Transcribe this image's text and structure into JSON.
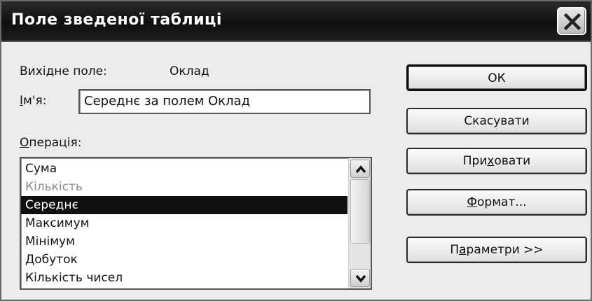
{
  "window": {
    "title": "Поле зведеної таблиці"
  },
  "source_field": {
    "label": "Вихідне поле:",
    "value": "Оклад"
  },
  "name_field": {
    "label_prefix": "І",
    "label_rest": "м'я:",
    "value": "Середнє за полем Оклад"
  },
  "operation": {
    "label_prefix": "О",
    "label_rest": "перація:",
    "items": [
      "Сума",
      "Кількість",
      "Середнє",
      "Максимум",
      "Мінімум",
      "Добуток",
      "Кількість чисел"
    ],
    "selected": "Середнє"
  },
  "buttons": {
    "ok": "ОК",
    "cancel": "Скасувати",
    "hide_before": "При",
    "hide_key": "х",
    "hide_after": "овати",
    "format_key": "Ф",
    "format_after": "ормат...",
    "params_before": "П",
    "params_key": "а",
    "params_after": "раметри >>"
  },
  "icons": {
    "close": "close-icon",
    "scroll_up": "chevron-up-icon",
    "scroll_down": "chevron-down-icon"
  }
}
